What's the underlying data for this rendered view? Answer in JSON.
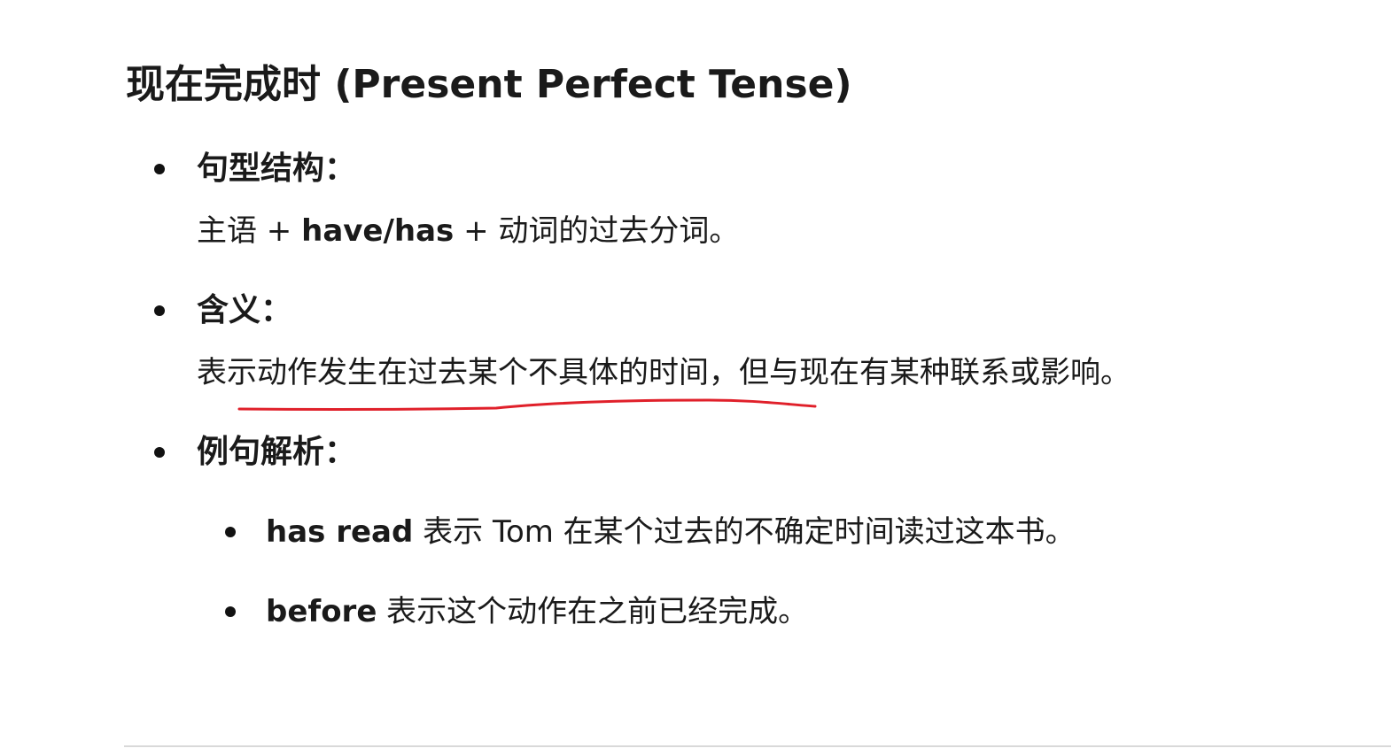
{
  "heading": "现在完成时 (Present Perfect Tense)",
  "sections": [
    {
      "label": "句型结构：",
      "body": {
        "prefix": "主语 + ",
        "bold": "have/has",
        "suffix": " + 动词的过去分词。"
      }
    },
    {
      "label": "含义：",
      "body": {
        "text": "表示动作发生在过去某个不具体的时间，但与现在有某种联系或影响。"
      }
    },
    {
      "label": "例句解析：",
      "examples": [
        {
          "bold": "has read",
          "text": " 表示 Tom 在某个过去的不确定时间读过这本书。"
        },
        {
          "bold": "before",
          "text": " 表示这个动作在之前已经完成。"
        }
      ]
    }
  ],
  "annotation": {
    "color": "#e0202a",
    "underlined_text": "表示动作发生在过去某个不具体的时间"
  },
  "colors": {
    "text": "#1a1a1a",
    "divider": "#d9d9d9"
  }
}
